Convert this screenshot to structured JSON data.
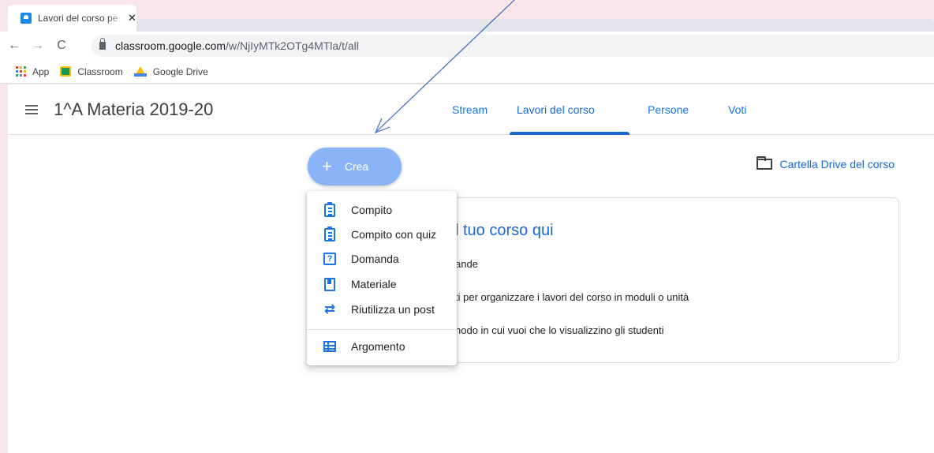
{
  "browser": {
    "tab_title": "Lavori del corso pe",
    "tab_close": "✕",
    "url_domain": "classroom.google.com",
    "url_path": "/w/NjIyMTk2OTg4MTla/t/all",
    "nav": {
      "back": "←",
      "forward": "→",
      "reload": "C"
    },
    "bookmarks": [
      {
        "label": "App",
        "icon": "apps-grid-icon"
      },
      {
        "label": "Classroom",
        "icon": "classroom-icon"
      },
      {
        "label": "Google Drive",
        "icon": "google-drive-icon"
      }
    ]
  },
  "classroom": {
    "course_title": "1^A Materia 2019-20",
    "tabs": [
      {
        "label": "Stream",
        "active": false
      },
      {
        "label": "Lavori del corso",
        "active": true
      },
      {
        "label": "Persone",
        "active": false
      },
      {
        "label": "Voti",
        "active": false
      }
    ],
    "create_button": {
      "plus": "+",
      "label": "Crea"
    },
    "drive_folder_link": "Cartella Drive del corso",
    "card": {
      "title": "l tuo corso qui",
      "lines": [
        "ande",
        "ti per organizzare i lavori del corso in moduli o unità",
        "nodo in cui vuoi che lo visualizzino gli studenti"
      ]
    },
    "create_menu": [
      {
        "label": "Compito",
        "icon": "assignment-icon"
      },
      {
        "label": "Compito con quiz",
        "icon": "quiz-assignment-icon"
      },
      {
        "label": "Domanda",
        "icon": "question-icon",
        "glyph": "?"
      },
      {
        "label": "Materiale",
        "icon": "material-icon"
      },
      {
        "label": "Riutilizza un post",
        "icon": "reuse-icon",
        "glyph": "⇄"
      },
      {
        "label": "Argomento",
        "icon": "topic-icon"
      }
    ]
  },
  "colors": {
    "accent": "#1967d2",
    "create_button": "#8ab4f8",
    "annotation_arrow": "#3b6bc7",
    "page_background": "#f9e6ea"
  }
}
